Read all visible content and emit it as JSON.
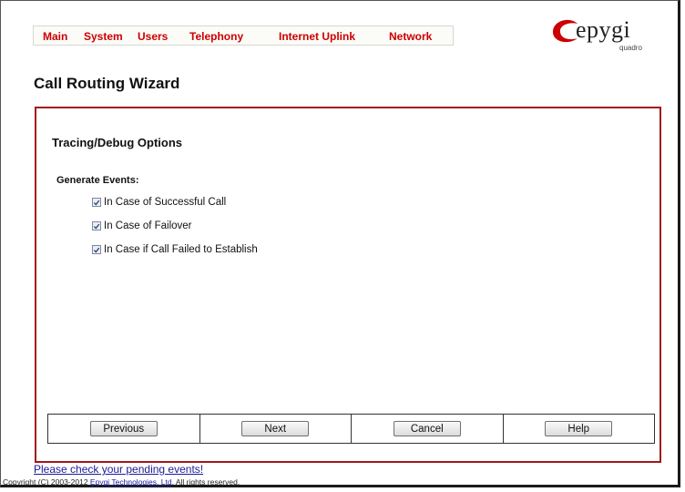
{
  "nav": {
    "items": [
      {
        "label": "Main"
      },
      {
        "label": "System"
      },
      {
        "label": "Users"
      },
      {
        "label": "Telephony"
      },
      {
        "label": "Internet Uplink"
      },
      {
        "label": "Network"
      }
    ]
  },
  "logo": {
    "text": "epygi",
    "subtext": "quadro",
    "brand_color": "#cc0000"
  },
  "page": {
    "title": "Call Routing Wizard"
  },
  "panel": {
    "section_title": "Tracing/Debug Options",
    "group_label": "Generate Events:",
    "options": [
      {
        "label": "In Case of Successful Call",
        "checked": true
      },
      {
        "label": "In Case of Failover",
        "checked": true
      },
      {
        "label": "In Case if Call Failed to Establish",
        "checked": true
      }
    ],
    "border_color": "#a01818"
  },
  "buttons": {
    "previous": "Previous",
    "next": "Next",
    "cancel": "Cancel",
    "help": "Help"
  },
  "footer": {
    "pending_link": "Please check your pending events!",
    "copyright_prefix": "Copyright (C) 2003-2012 ",
    "copyright_link": "Epygi Technologies, Ltd",
    "copyright_suffix": ". All rights reserved."
  }
}
